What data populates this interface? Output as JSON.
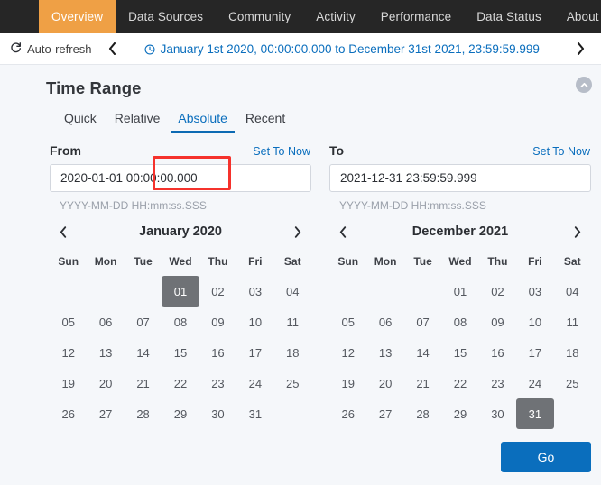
{
  "topnav": {
    "items": [
      {
        "label": "Overview",
        "active": true
      },
      {
        "label": "Data Sources",
        "active": false
      },
      {
        "label": "Community",
        "active": false
      },
      {
        "label": "Activity",
        "active": false
      },
      {
        "label": "Performance",
        "active": false
      },
      {
        "label": "Data Status",
        "active": false
      },
      {
        "label": "About",
        "active": false
      }
    ],
    "active_bg": "#efa045",
    "bg": "#262626"
  },
  "timebar": {
    "autorefresh_label": "Auto-refresh",
    "refresh_icon": "refresh-icon",
    "prev_icon": "chevron-left-icon",
    "next_icon": "chevron-right-icon",
    "clock_icon": "clock-icon",
    "range_text": "January 1st 2020, 00:00:00.000 to December 31st 2021, 23:59:59.999",
    "range_color": "#0a6ebd"
  },
  "panel": {
    "title": "Time Range",
    "collapse_icon": "chevron-up-circle-icon",
    "tabs": [
      {
        "label": "Quick",
        "active": false
      },
      {
        "label": "Relative",
        "active": false
      },
      {
        "label": "Absolute",
        "active": true
      },
      {
        "label": "Recent",
        "active": false
      }
    ],
    "highlight_color": "#f5322c",
    "accent_color": "#0a6ebd"
  },
  "from": {
    "label": "From",
    "set_to_now": "Set To Now",
    "value": "2020-01-01 00:00:00.000",
    "placeholder": "YYYY-MM-DD HH:mm:ss.SSS",
    "hint": "YYYY-MM-DD HH:mm:ss.SSS"
  },
  "to": {
    "label": "To",
    "set_to_now": "Set To Now",
    "value": "2021-12-31 23:59:59.999",
    "placeholder": "YYYY-MM-DD HH:mm:ss.SSS",
    "hint": "YYYY-MM-DD HH:mm:ss.SSS"
  },
  "calendar_left": {
    "month_label": "January 2020",
    "prev_icon": "chevron-left-icon",
    "next_icon": "chevron-right-icon",
    "dow": [
      "Sun",
      "Mon",
      "Tue",
      "Wed",
      "Thu",
      "Fri",
      "Sat"
    ],
    "lead_blanks": 3,
    "days": [
      "01",
      "02",
      "03",
      "04",
      "05",
      "06",
      "07",
      "08",
      "09",
      "10",
      "11",
      "12",
      "13",
      "14",
      "15",
      "16",
      "17",
      "18",
      "19",
      "20",
      "21",
      "22",
      "23",
      "24",
      "25",
      "26",
      "27",
      "28",
      "29",
      "30",
      "31"
    ],
    "selected_day": "01",
    "selected_bg": "#6f7276"
  },
  "calendar_right": {
    "month_label": "December 2021",
    "prev_icon": "chevron-left-icon",
    "next_icon": "chevron-right-icon",
    "dow": [
      "Sun",
      "Mon",
      "Tue",
      "Wed",
      "Thu",
      "Fri",
      "Sat"
    ],
    "lead_blanks": 3,
    "days": [
      "01",
      "02",
      "03",
      "04",
      "05",
      "06",
      "07",
      "08",
      "09",
      "10",
      "11",
      "12",
      "13",
      "14",
      "15",
      "16",
      "17",
      "18",
      "19",
      "20",
      "21",
      "22",
      "23",
      "24",
      "25",
      "26",
      "27",
      "28",
      "29",
      "30",
      "31"
    ],
    "selected_day": "31",
    "selected_bg": "#6f7276"
  },
  "footer": {
    "go_label": "Go",
    "go_color": "#0a6ebd"
  }
}
